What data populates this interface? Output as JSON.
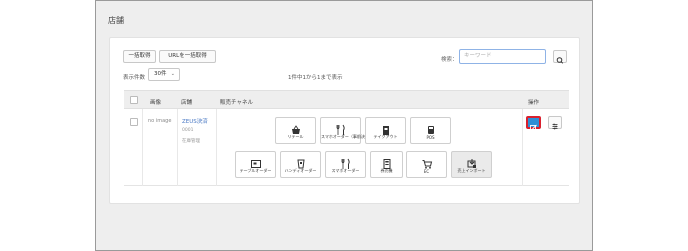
{
  "page": {
    "title": "店舗"
  },
  "toolbar": {
    "bulk_get_label": "一括取得",
    "url_bulk_get_label": "URLを一括取得",
    "search_label": "検索：",
    "search_placeholder": "キーワード",
    "per_page_label": "表示件数",
    "per_page_value": "30件",
    "count_text": "1件中1から1まで表示"
  },
  "table": {
    "headers": {
      "image": "画像",
      "store": "店舗",
      "channel": "販売チャネル",
      "actions": "操作"
    },
    "rows": [
      {
        "image_text": "no image",
        "store_name": "ZEUS決済",
        "store_code": "0001",
        "store_sub": "在庫管理",
        "channels": [
          {
            "label": "リテール",
            "icon": "cart-basket-icon"
          },
          {
            "label": "スマホオーダー（事前決済）",
            "icon": "fork-knife-icon"
          },
          {
            "label": "テイクアウト",
            "icon": "takeout-bag-icon"
          },
          {
            "label": "POS",
            "icon": "pos-terminal-icon"
          },
          {
            "label": "テーブルオーダー",
            "icon": "tablet-icon"
          },
          {
            "label": "ハンディオーダー",
            "icon": "handheld-icon"
          },
          {
            "label": "スマホオーダー",
            "icon": "fork-knife-icon"
          },
          {
            "label": "券売機",
            "icon": "ticket-machine-icon"
          },
          {
            "label": "EC",
            "icon": "shopping-cart-icon"
          },
          {
            "label": "売上インポート",
            "icon": "import-icon",
            "selected": true
          }
        ]
      }
    ]
  },
  "colors": {
    "edit_button": "#2e8fd6",
    "highlight_border": "#d9202e",
    "link": "#4a79c4"
  }
}
